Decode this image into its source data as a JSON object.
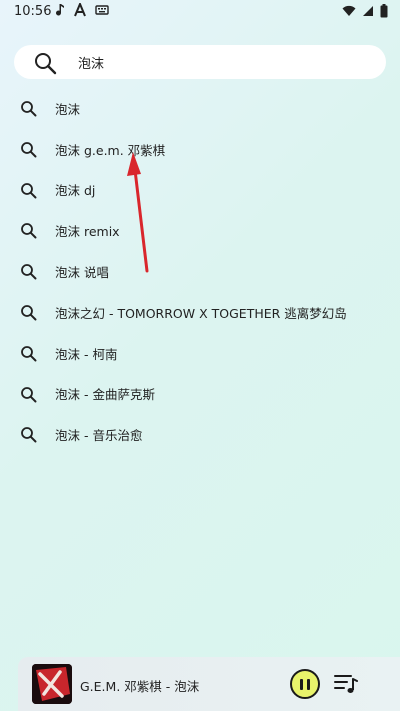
{
  "status_bar": {
    "time": "10:56",
    "left_icons": [
      "music-note-icon",
      "text-a-icon",
      "keyboard-icon"
    ],
    "right_icons": [
      "wifi-icon",
      "signal-icon",
      "battery-icon"
    ]
  },
  "search": {
    "value": "泡沫",
    "icon": "search-icon"
  },
  "suggestions": [
    {
      "label": "泡沫"
    },
    {
      "label": "泡沫 g.e.m. 邓紫棋"
    },
    {
      "label": "泡沫 dj"
    },
    {
      "label": "泡沫 remix"
    },
    {
      "label": "泡沫 说唱"
    },
    {
      "label": "泡沫之幻 - TOMORROW X TOGETHER 逃离梦幻岛"
    },
    {
      "label": "泡沫 - 柯南"
    },
    {
      "label": "泡沫 - 金曲萨克斯"
    },
    {
      "label": "泡沫 - 音乐治愈"
    }
  ],
  "player": {
    "now_playing": "G.E.M. 邓紫棋 - 泡沫",
    "pause_icon": "pause-icon",
    "playlist_icon": "playlist-icon",
    "accent": "#e8f36b"
  },
  "annotation": {
    "arrow_color": "#d9262c"
  }
}
